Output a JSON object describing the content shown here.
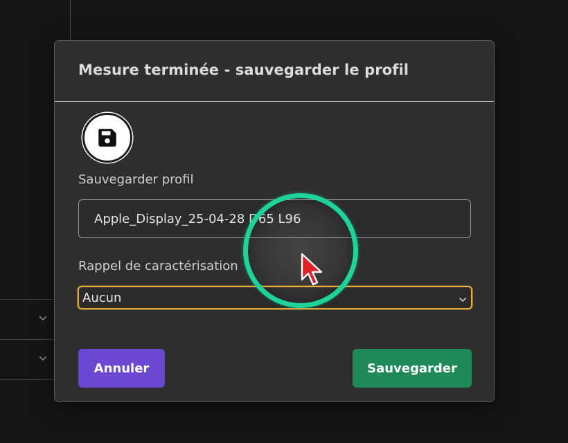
{
  "dialog": {
    "title": "Mesure terminée - sauvegarder le profil",
    "icon": "floppy-disk-icon",
    "profile_label": "Sauvegarder profil",
    "profile_name_value": "Apple_Display_25-04-28 D65 L96",
    "recall_label": "Rappel de caractérisation",
    "recall_selected": "Aucun",
    "cancel_label": "Annuler",
    "save_label": "Sauvegarder"
  },
  "colors": {
    "modal_bg": "#2e2e2e",
    "cancel_button": "#6c47d4",
    "save_button": "#1f8a57",
    "select_focus_border": "#e6a93c",
    "click_indicator": "#1ed39a",
    "cursor": "#e0202a"
  }
}
